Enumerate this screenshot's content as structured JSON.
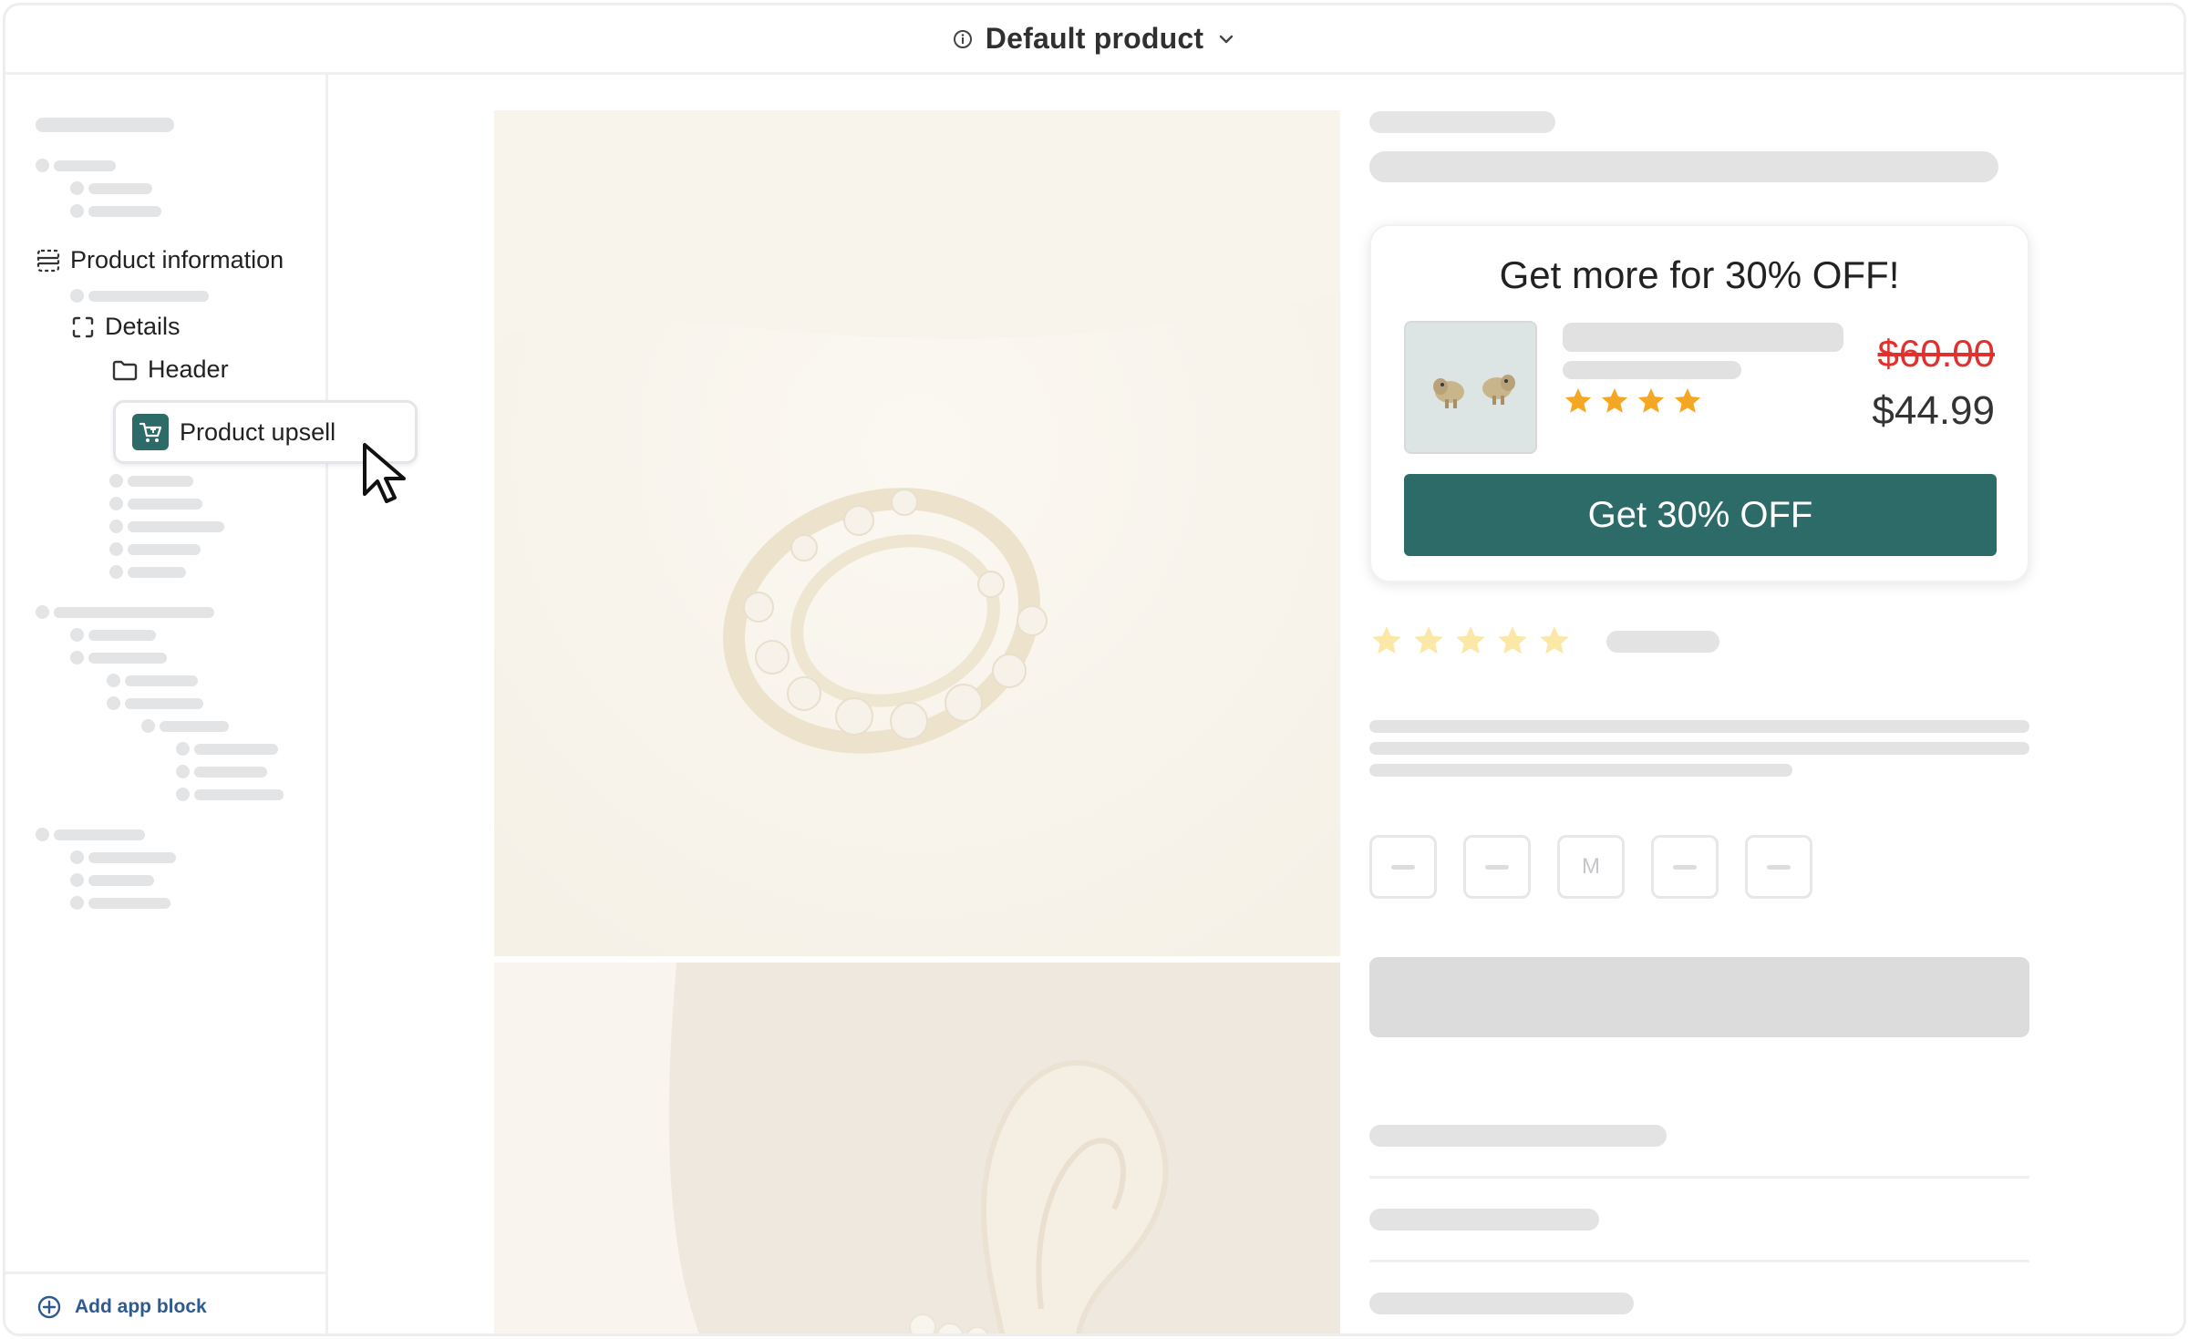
{
  "header": {
    "title": "Default product"
  },
  "sidebar": {
    "section_label": "Product information",
    "details_label": "Details",
    "header_label": "Header",
    "upsell_block_label": "Product upsell",
    "add_block_label": "Add app block"
  },
  "upsell_card": {
    "headline": "Get more for 30% OFF!",
    "original_price": "$60.00",
    "sale_price": "$44.99",
    "cta_label": "Get 30% OFF",
    "rating_stars": 4
  },
  "variants": {
    "middle_option": "M"
  },
  "colors": {
    "brand": "#2c6b68",
    "strike_price": "#e0312f",
    "star": "#f5a623",
    "link": "#2e5a8f"
  }
}
